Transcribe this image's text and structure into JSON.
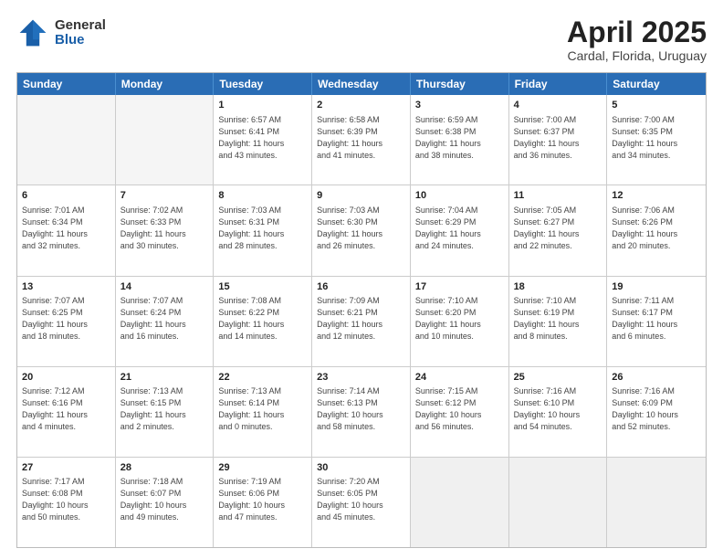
{
  "logo": {
    "general": "General",
    "blue": "Blue"
  },
  "title": {
    "month": "April 2025",
    "location": "Cardal, Florida, Uruguay"
  },
  "calendar": {
    "headers": [
      "Sunday",
      "Monday",
      "Tuesday",
      "Wednesday",
      "Thursday",
      "Friday",
      "Saturday"
    ],
    "rows": [
      [
        {
          "day": "",
          "detail": "",
          "empty": true
        },
        {
          "day": "",
          "detail": "",
          "empty": true
        },
        {
          "day": "1",
          "detail": "Sunrise: 6:57 AM\nSunset: 6:41 PM\nDaylight: 11 hours\nand 43 minutes."
        },
        {
          "day": "2",
          "detail": "Sunrise: 6:58 AM\nSunset: 6:39 PM\nDaylight: 11 hours\nand 41 minutes."
        },
        {
          "day": "3",
          "detail": "Sunrise: 6:59 AM\nSunset: 6:38 PM\nDaylight: 11 hours\nand 38 minutes."
        },
        {
          "day": "4",
          "detail": "Sunrise: 7:00 AM\nSunset: 6:37 PM\nDaylight: 11 hours\nand 36 minutes."
        },
        {
          "day": "5",
          "detail": "Sunrise: 7:00 AM\nSunset: 6:35 PM\nDaylight: 11 hours\nand 34 minutes."
        }
      ],
      [
        {
          "day": "6",
          "detail": "Sunrise: 7:01 AM\nSunset: 6:34 PM\nDaylight: 11 hours\nand 32 minutes."
        },
        {
          "day": "7",
          "detail": "Sunrise: 7:02 AM\nSunset: 6:33 PM\nDaylight: 11 hours\nand 30 minutes."
        },
        {
          "day": "8",
          "detail": "Sunrise: 7:03 AM\nSunset: 6:31 PM\nDaylight: 11 hours\nand 28 minutes."
        },
        {
          "day": "9",
          "detail": "Sunrise: 7:03 AM\nSunset: 6:30 PM\nDaylight: 11 hours\nand 26 minutes."
        },
        {
          "day": "10",
          "detail": "Sunrise: 7:04 AM\nSunset: 6:29 PM\nDaylight: 11 hours\nand 24 minutes."
        },
        {
          "day": "11",
          "detail": "Sunrise: 7:05 AM\nSunset: 6:27 PM\nDaylight: 11 hours\nand 22 minutes."
        },
        {
          "day": "12",
          "detail": "Sunrise: 7:06 AM\nSunset: 6:26 PM\nDaylight: 11 hours\nand 20 minutes."
        }
      ],
      [
        {
          "day": "13",
          "detail": "Sunrise: 7:07 AM\nSunset: 6:25 PM\nDaylight: 11 hours\nand 18 minutes."
        },
        {
          "day": "14",
          "detail": "Sunrise: 7:07 AM\nSunset: 6:24 PM\nDaylight: 11 hours\nand 16 minutes."
        },
        {
          "day": "15",
          "detail": "Sunrise: 7:08 AM\nSunset: 6:22 PM\nDaylight: 11 hours\nand 14 minutes."
        },
        {
          "day": "16",
          "detail": "Sunrise: 7:09 AM\nSunset: 6:21 PM\nDaylight: 11 hours\nand 12 minutes."
        },
        {
          "day": "17",
          "detail": "Sunrise: 7:10 AM\nSunset: 6:20 PM\nDaylight: 11 hours\nand 10 minutes."
        },
        {
          "day": "18",
          "detail": "Sunrise: 7:10 AM\nSunset: 6:19 PM\nDaylight: 11 hours\nand 8 minutes."
        },
        {
          "day": "19",
          "detail": "Sunrise: 7:11 AM\nSunset: 6:17 PM\nDaylight: 11 hours\nand 6 minutes."
        }
      ],
      [
        {
          "day": "20",
          "detail": "Sunrise: 7:12 AM\nSunset: 6:16 PM\nDaylight: 11 hours\nand 4 minutes."
        },
        {
          "day": "21",
          "detail": "Sunrise: 7:13 AM\nSunset: 6:15 PM\nDaylight: 11 hours\nand 2 minutes."
        },
        {
          "day": "22",
          "detail": "Sunrise: 7:13 AM\nSunset: 6:14 PM\nDaylight: 11 hours\nand 0 minutes."
        },
        {
          "day": "23",
          "detail": "Sunrise: 7:14 AM\nSunset: 6:13 PM\nDaylight: 10 hours\nand 58 minutes."
        },
        {
          "day": "24",
          "detail": "Sunrise: 7:15 AM\nSunset: 6:12 PM\nDaylight: 10 hours\nand 56 minutes."
        },
        {
          "day": "25",
          "detail": "Sunrise: 7:16 AM\nSunset: 6:10 PM\nDaylight: 10 hours\nand 54 minutes."
        },
        {
          "day": "26",
          "detail": "Sunrise: 7:16 AM\nSunset: 6:09 PM\nDaylight: 10 hours\nand 52 minutes."
        }
      ],
      [
        {
          "day": "27",
          "detail": "Sunrise: 7:17 AM\nSunset: 6:08 PM\nDaylight: 10 hours\nand 50 minutes."
        },
        {
          "day": "28",
          "detail": "Sunrise: 7:18 AM\nSunset: 6:07 PM\nDaylight: 10 hours\nand 49 minutes."
        },
        {
          "day": "29",
          "detail": "Sunrise: 7:19 AM\nSunset: 6:06 PM\nDaylight: 10 hours\nand 47 minutes."
        },
        {
          "day": "30",
          "detail": "Sunrise: 7:20 AM\nSunset: 6:05 PM\nDaylight: 10 hours\nand 45 minutes."
        },
        {
          "day": "",
          "detail": "",
          "empty": true,
          "shaded": true
        },
        {
          "day": "",
          "detail": "",
          "empty": true,
          "shaded": true
        },
        {
          "day": "",
          "detail": "",
          "empty": true,
          "shaded": true
        }
      ]
    ]
  }
}
